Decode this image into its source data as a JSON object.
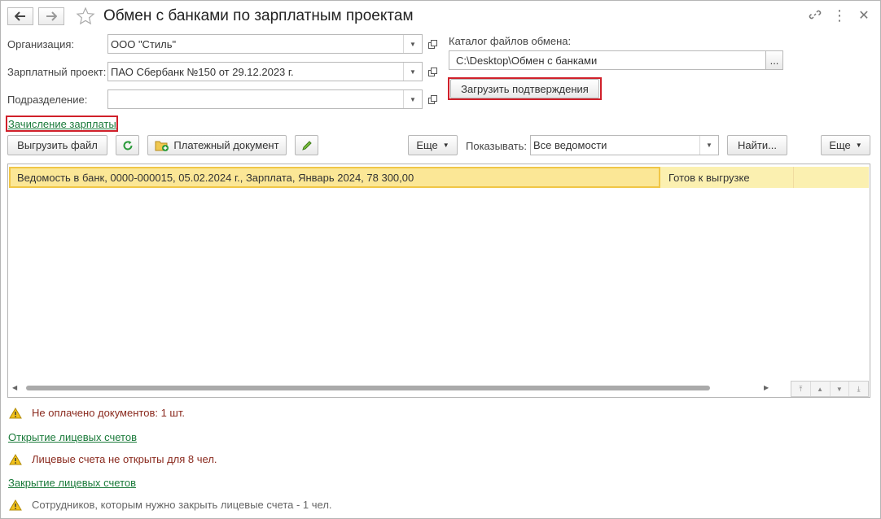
{
  "window": {
    "title": "Обмен с банками по зарплатным проектам",
    "back_icon": "arrow-left-icon",
    "forward_icon": "arrow-right-icon",
    "favorite_icon": "star-icon",
    "link_icon": "link-icon",
    "more_icon": "more-vert-icon",
    "close_icon": "close-icon"
  },
  "form": {
    "organization_label": "Организация:",
    "organization_value": "ООО \"Стиль\"",
    "project_label": "Зарплатный проект:",
    "project_value": "ПАО Сбербанк №150 от 29.12.2023 г.",
    "division_label": "Подразделение:",
    "division_value": "",
    "catalog_label": "Каталог файлов обмена:",
    "catalog_value": "C:\\Desktop\\Обмен с банками",
    "catalog_browse": "...",
    "load_confirmations_button": "Загрузить подтверждения"
  },
  "section_link": "Зачисление зарплаты",
  "toolbar": {
    "export_file": "Выгрузить файл",
    "payment_document": "Платежный документ",
    "more1": "Еще",
    "show_label": "Показывать:",
    "show_value": "Все ведомости",
    "find": "Найти...",
    "more2": "Еще"
  },
  "table": {
    "rows": [
      {
        "document": "Ведомость в банк, 0000-000015, 05.02.2024 г., Зарплата, Январь 2024, 78 300,00",
        "status": "Готов к выгрузке"
      }
    ]
  },
  "messages": {
    "unpaid": "Не оплачено документов: 1 шт.",
    "open_accounts_link": "Открытие лицевых счетов",
    "accounts_not_open": "Лицевые счета не открыты для 8 чел.",
    "close_accounts_link": "Закрытие лицевых счетов",
    "employees_to_close": "Сотрудников, которым нужно закрыть лицевые счета - 1 чел."
  },
  "colors": {
    "link": "#1a7a3a",
    "warning_text": "#8a2a1e",
    "highlight_border": "#d0202a",
    "selected_row": "#fbe796"
  }
}
